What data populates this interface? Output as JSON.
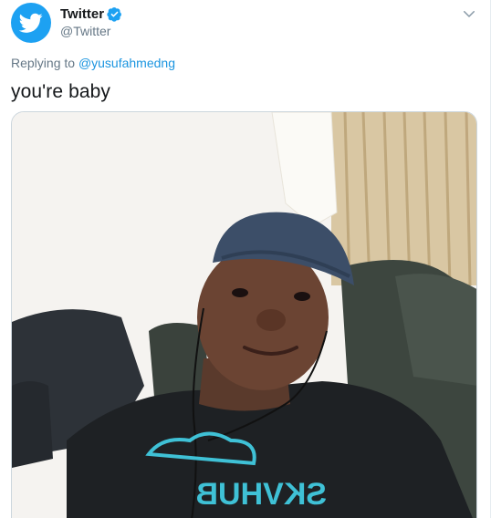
{
  "author": {
    "display_name": "Twitter",
    "handle": "@Twitter",
    "avatar_icon": "twitter-bird-icon",
    "verified_icon": "verified-badge-icon",
    "brand_color": "#1da1f2"
  },
  "menu": {
    "icon": "chevron-down-icon"
  },
  "reply": {
    "prefix": "Replying to",
    "mention": "@yusufahmedng"
  },
  "tweet": {
    "text": "you're baby"
  },
  "media": {
    "shirt_text": "SKVHUB"
  }
}
